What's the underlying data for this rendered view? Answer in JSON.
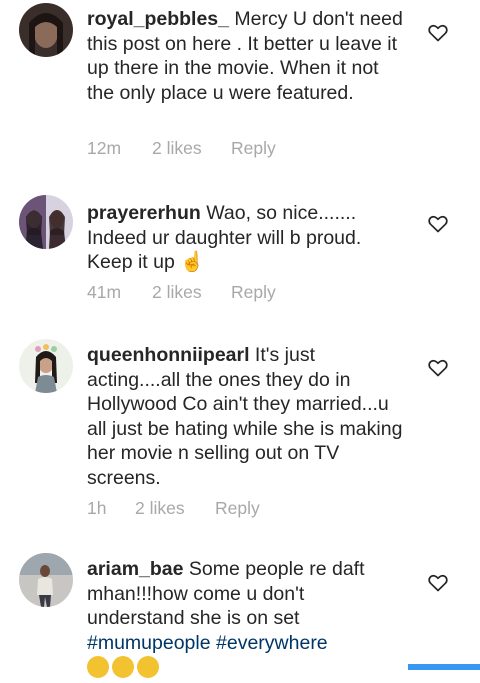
{
  "comments": [
    {
      "username": "royal_pebbles_",
      "text": " Mercy U don't need this post on here . It better u leave it up there in the movie. When it not the only place u were featured.",
      "time": "12m",
      "likes": "2 likes",
      "reply": "Reply"
    },
    {
      "username": "prayererhun",
      "text": " Wao, so nice....... Indeed ur daughter will b proud. Keep it up ",
      "emoji": "☝",
      "time": "41m",
      "likes": "2 likes",
      "reply": "Reply"
    },
    {
      "username": "queenhonniipearl",
      "text": " It's just acting....all the ones they do in Hollywood Co ain't they married...u all just be hating while she is making her movie n selling out on TV screens.",
      "time": "1h",
      "likes": "2 likes",
      "reply": "Reply"
    },
    {
      "username": "ariam_bae",
      "text": " Some people re daft mhan!!!how come u don't understand she is on set ",
      "hashtags": [
        "#mumupeople",
        "#everywhere"
      ]
    }
  ],
  "icons": {
    "like": "heart-outline-icon"
  },
  "colors": {
    "meta": "#a8a8a8",
    "hashtag": "#003569",
    "accent": "#3897f0"
  }
}
